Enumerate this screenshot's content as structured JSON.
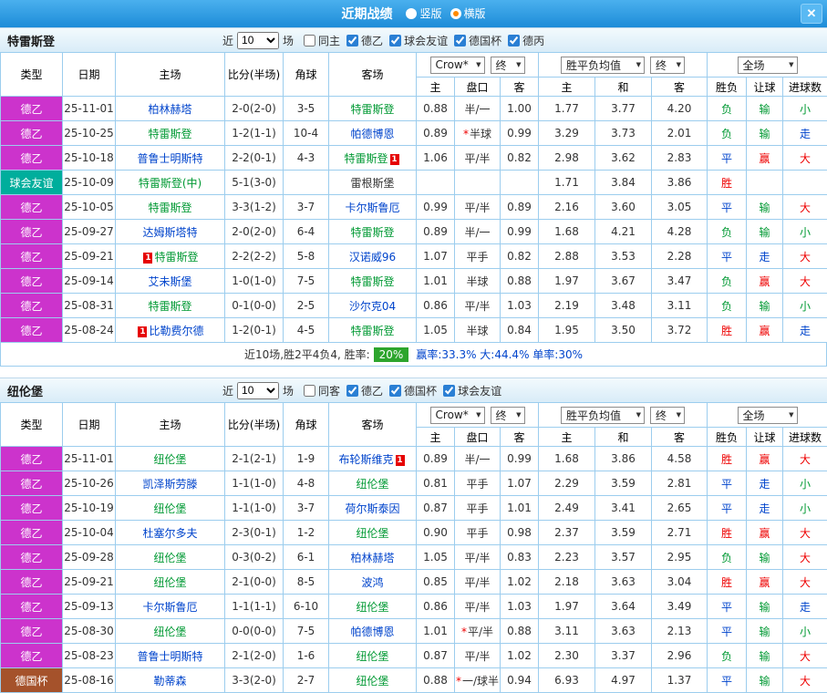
{
  "titlebar": {
    "title": "近期战绩",
    "radios": [
      {
        "label": "竖版",
        "selected": false
      },
      {
        "label": "横版",
        "selected": true
      }
    ],
    "close_glyph": "✕"
  },
  "dropdowns": {
    "company": "Crow*",
    "final": "终",
    "avg": "胜平负均值",
    "fulltime": "全场"
  },
  "table_headers": {
    "type": "类型",
    "date": "日期",
    "home": "主场",
    "score": "比分(半场)",
    "corners": "角球",
    "away": "客场",
    "odds_home": "主",
    "handicap": "盘口",
    "odds_away": "客",
    "avg_home": "主",
    "avg_draw": "和",
    "avg_away": "客",
    "result": "胜负",
    "let": "让球",
    "goals": "进球数"
  },
  "league_colors": {
    "德乙": "#cc33cc",
    "球会友谊": "#00ae9c",
    "德国杯": "#a5522b"
  },
  "sections": [
    {
      "team": "特雷斯登",
      "filters": {
        "prefix": "近",
        "count": "10",
        "suffix": "场",
        "options": [
          {
            "label": "同主",
            "checked": false
          },
          {
            "label": "德乙",
            "checked": true
          },
          {
            "label": "球会友谊",
            "checked": true
          },
          {
            "label": "德国杯",
            "checked": true
          },
          {
            "label": "德丙",
            "checked": true
          }
        ]
      },
      "rows": [
        {
          "league": "德乙",
          "date": "25-11-01",
          "home": "柏林赫塔",
          "home_style": "opp",
          "home_card": "",
          "home_card_pos": "",
          "score": "2-0(2-0)",
          "corners": "3-5",
          "away": "特雷斯登",
          "away_style": "focus",
          "away_card": "",
          "away_card_pos": "",
          "odds_home": "0.88",
          "handicap": "半/一",
          "odds_away": "1.00",
          "avg_home": "1.77",
          "avg_draw": "3.77",
          "avg_away": "4.20",
          "result": "负",
          "let_result": "输",
          "goals": "小"
        },
        {
          "league": "德乙",
          "date": "25-10-25",
          "home": "特雷斯登",
          "home_style": "focus",
          "home_card": "",
          "home_card_pos": "",
          "score": "1-2(1-1)",
          "corners": "10-4",
          "away": "帕德博恩",
          "away_style": "opp",
          "away_card": "",
          "away_card_pos": "",
          "odds_home": "0.89",
          "handicap": "*半球",
          "odds_away": "0.99",
          "avg_home": "3.29",
          "avg_draw": "3.73",
          "avg_away": "2.01",
          "result": "负",
          "let_result": "输",
          "goals": "走"
        },
        {
          "league": "德乙",
          "date": "25-10-18",
          "home": "普鲁士明斯特",
          "home_style": "opp",
          "home_card": "",
          "home_card_pos": "",
          "score": "2-2(0-1)",
          "corners": "4-3",
          "away": "特雷斯登",
          "away_style": "focus",
          "away_card": "1",
          "away_card_pos": "after",
          "odds_home": "1.06",
          "handicap": "平/半",
          "odds_away": "0.82",
          "avg_home": "2.98",
          "avg_draw": "3.62",
          "avg_away": "2.83",
          "result": "平",
          "let_result": "赢",
          "goals": "大"
        },
        {
          "league": "球会友谊",
          "date": "25-10-09",
          "home": "特雷斯登(中)",
          "home_style": "focus",
          "home_card": "",
          "home_card_pos": "",
          "score": "5-1(3-0)",
          "corners": "",
          "away": "雷根斯堡",
          "away_style": "plain",
          "away_card": "",
          "away_card_pos": "",
          "odds_home": "",
          "handicap": "",
          "odds_away": "",
          "avg_home": "1.71",
          "avg_draw": "3.84",
          "avg_away": "3.86",
          "result": "胜",
          "let_result": "",
          "goals": ""
        },
        {
          "league": "德乙",
          "date": "25-10-05",
          "home": "特雷斯登",
          "home_style": "focus",
          "home_card": "",
          "home_card_pos": "",
          "score": "3-3(1-2)",
          "corners": "3-7",
          "away": "卡尔斯鲁厄",
          "away_style": "opp",
          "away_card": "",
          "away_card_pos": "",
          "odds_home": "0.99",
          "handicap": "平/半",
          "odds_away": "0.89",
          "avg_home": "2.16",
          "avg_draw": "3.60",
          "avg_away": "3.05",
          "result": "平",
          "let_result": "输",
          "goals": "大"
        },
        {
          "league": "德乙",
          "date": "25-09-27",
          "home": "达姆斯塔特",
          "home_style": "opp",
          "home_card": "",
          "home_card_pos": "",
          "score": "2-0(2-0)",
          "corners": "6-4",
          "away": "特雷斯登",
          "away_style": "focus",
          "away_card": "",
          "away_card_pos": "",
          "odds_home": "0.89",
          "handicap": "半/一",
          "odds_away": "0.99",
          "avg_home": "1.68",
          "avg_draw": "4.21",
          "avg_away": "4.28",
          "result": "负",
          "let_result": "输",
          "goals": "小"
        },
        {
          "league": "德乙",
          "date": "25-09-21",
          "home": "特雷斯登",
          "home_style": "focus",
          "home_card": "1",
          "home_card_pos": "before",
          "score": "2-2(2-2)",
          "corners": "5-8",
          "away": "汉诺威96",
          "away_style": "opp",
          "away_card": "",
          "away_card_pos": "",
          "odds_home": "1.07",
          "handicap": "平手",
          "odds_away": "0.82",
          "avg_home": "2.88",
          "avg_draw": "3.53",
          "avg_away": "2.28",
          "result": "平",
          "let_result": "走",
          "goals": "大"
        },
        {
          "league": "德乙",
          "date": "25-09-14",
          "home": "艾未斯堡",
          "home_style": "opp",
          "home_card": "",
          "home_card_pos": "",
          "score": "1-0(1-0)",
          "corners": "7-5",
          "away": "特雷斯登",
          "away_style": "focus",
          "away_card": "",
          "away_card_pos": "",
          "odds_home": "1.01",
          "handicap": "半球",
          "odds_away": "0.88",
          "avg_home": "1.97",
          "avg_draw": "3.67",
          "avg_away": "3.47",
          "result": "负",
          "let_result": "赢",
          "goals": "大"
        },
        {
          "league": "德乙",
          "date": "25-08-31",
          "home": "特雷斯登",
          "home_style": "focus",
          "home_card": "",
          "home_card_pos": "",
          "score": "0-1(0-0)",
          "corners": "2-5",
          "away": "沙尔克04",
          "away_style": "opp",
          "away_card": "",
          "away_card_pos": "",
          "odds_home": "0.86",
          "handicap": "平/半",
          "odds_away": "1.03",
          "avg_home": "2.19",
          "avg_draw": "3.48",
          "avg_away": "3.11",
          "result": "负",
          "let_result": "输",
          "goals": "小"
        },
        {
          "league": "德乙",
          "date": "25-08-24",
          "home": "比勒费尔德",
          "home_style": "opp",
          "home_card": "1",
          "home_card_pos": "before",
          "score": "1-2(0-1)",
          "corners": "4-5",
          "away": "特雷斯登",
          "away_style": "focus",
          "away_card": "",
          "away_card_pos": "",
          "odds_home": "1.05",
          "handicap": "半球",
          "odds_away": "0.84",
          "avg_home": "1.95",
          "avg_draw": "3.50",
          "avg_away": "3.72",
          "result": "胜",
          "let_result": "赢",
          "goals": "走"
        }
      ],
      "summary": {
        "before": "近10场,胜2平4负4, 胜率:",
        "badge": "20%",
        "after": "赢率:33.3% 大:44.4% 单率:30%"
      }
    },
    {
      "team": "纽伦堡",
      "filters": {
        "prefix": "近",
        "count": "10",
        "suffix": "场",
        "options": [
          {
            "label": "同客",
            "checked": false
          },
          {
            "label": "德乙",
            "checked": true
          },
          {
            "label": "德国杯",
            "checked": true
          },
          {
            "label": "球会友谊",
            "checked": true
          }
        ]
      },
      "rows": [
        {
          "league": "德乙",
          "date": "25-11-01",
          "home": "纽伦堡",
          "home_style": "focus",
          "home_card": "",
          "home_card_pos": "",
          "score": "2-1(2-1)",
          "corners": "1-9",
          "away": "布轮斯维克",
          "away_style": "opp",
          "away_card": "1",
          "away_card_pos": "after",
          "odds_home": "0.89",
          "handicap": "半/一",
          "odds_away": "0.99",
          "avg_home": "1.68",
          "avg_draw": "3.86",
          "avg_away": "4.58",
          "result": "胜",
          "let_result": "赢",
          "goals": "大"
        },
        {
          "league": "德乙",
          "date": "25-10-26",
          "home": "凯泽斯劳滕",
          "home_style": "opp",
          "home_card": "",
          "home_card_pos": "",
          "score": "1-1(1-0)",
          "corners": "4-8",
          "away": "纽伦堡",
          "away_style": "focus",
          "away_card": "",
          "away_card_pos": "",
          "odds_home": "0.81",
          "handicap": "平手",
          "odds_away": "1.07",
          "avg_home": "2.29",
          "avg_draw": "3.59",
          "avg_away": "2.81",
          "result": "平",
          "let_result": "走",
          "goals": "小"
        },
        {
          "league": "德乙",
          "date": "25-10-19",
          "home": "纽伦堡",
          "home_style": "focus",
          "home_card": "",
          "home_card_pos": "",
          "score": "1-1(1-0)",
          "corners": "3-7",
          "away": "荷尔斯泰因",
          "away_style": "opp",
          "away_card": "",
          "away_card_pos": "",
          "odds_home": "0.87",
          "handicap": "平手",
          "odds_away": "1.01",
          "avg_home": "2.49",
          "avg_draw": "3.41",
          "avg_away": "2.65",
          "result": "平",
          "let_result": "走",
          "goals": "小"
        },
        {
          "league": "德乙",
          "date": "25-10-04",
          "home": "杜塞尔多夫",
          "home_style": "opp",
          "home_card": "",
          "home_card_pos": "",
          "score": "2-3(0-1)",
          "corners": "1-2",
          "away": "纽伦堡",
          "away_style": "focus",
          "away_card": "",
          "away_card_pos": "",
          "odds_home": "0.90",
          "handicap": "平手",
          "odds_away": "0.98",
          "avg_home": "2.37",
          "avg_draw": "3.59",
          "avg_away": "2.71",
          "result": "胜",
          "let_result": "赢",
          "goals": "大"
        },
        {
          "league": "德乙",
          "date": "25-09-28",
          "home": "纽伦堡",
          "home_style": "focus",
          "home_card": "",
          "home_card_pos": "",
          "score": "0-3(0-2)",
          "corners": "6-1",
          "away": "柏林赫塔",
          "away_style": "opp",
          "away_card": "",
          "away_card_pos": "",
          "odds_home": "1.05",
          "handicap": "平/半",
          "odds_away": "0.83",
          "avg_home": "2.23",
          "avg_draw": "3.57",
          "avg_away": "2.95",
          "result": "负",
          "let_result": "输",
          "goals": "大"
        },
        {
          "league": "德乙",
          "date": "25-09-21",
          "home": "纽伦堡",
          "home_style": "focus",
          "home_card": "",
          "home_card_pos": "",
          "score": "2-1(0-0)",
          "corners": "8-5",
          "away": "波鸿",
          "away_style": "opp",
          "away_card": "",
          "away_card_pos": "",
          "odds_home": "0.85",
          "handicap": "平/半",
          "odds_away": "1.02",
          "avg_home": "2.18",
          "avg_draw": "3.63",
          "avg_away": "3.04",
          "result": "胜",
          "let_result": "赢",
          "goals": "大"
        },
        {
          "league": "德乙",
          "date": "25-09-13",
          "home": "卡尔斯鲁厄",
          "home_style": "opp",
          "home_card": "",
          "home_card_pos": "",
          "score": "1-1(1-1)",
          "corners": "6-10",
          "away": "纽伦堡",
          "away_style": "focus",
          "away_card": "",
          "away_card_pos": "",
          "odds_home": "0.86",
          "handicap": "平/半",
          "odds_away": "1.03",
          "avg_home": "1.97",
          "avg_draw": "3.64",
          "avg_away": "3.49",
          "result": "平",
          "let_result": "输",
          "goals": "走"
        },
        {
          "league": "德乙",
          "date": "25-08-30",
          "home": "纽伦堡",
          "home_style": "focus",
          "home_card": "",
          "home_card_pos": "",
          "score": "0-0(0-0)",
          "corners": "7-5",
          "away": "帕德博恩",
          "away_style": "opp",
          "away_card": "",
          "away_card_pos": "",
          "odds_home": "1.01",
          "handicap": "*平/半",
          "odds_away": "0.88",
          "avg_home": "3.11",
          "avg_draw": "3.63",
          "avg_away": "2.13",
          "result": "平",
          "let_result": "输",
          "goals": "小"
        },
        {
          "league": "德乙",
          "date": "25-08-23",
          "home": "普鲁士明斯特",
          "home_style": "opp",
          "home_card": "",
          "home_card_pos": "",
          "score": "2-1(2-0)",
          "corners": "1-6",
          "away": "纽伦堡",
          "away_style": "focus",
          "away_card": "",
          "away_card_pos": "",
          "odds_home": "0.87",
          "handicap": "平/半",
          "odds_away": "1.02",
          "avg_home": "2.30",
          "avg_draw": "3.37",
          "avg_away": "2.96",
          "result": "负",
          "let_result": "输",
          "goals": "大"
        },
        {
          "league": "德国杯",
          "date": "25-08-16",
          "home": "勒蒂森",
          "home_style": "opp",
          "home_card": "",
          "home_card_pos": "",
          "score": "3-3(2-0)",
          "corners": "2-7",
          "away": "纽伦堡",
          "away_style": "focus",
          "away_card": "",
          "away_card_pos": "",
          "odds_home": "0.88",
          "handicap": "*一/球半",
          "odds_away": "0.94",
          "avg_home": "6.93",
          "avg_draw": "4.97",
          "avg_away": "1.37",
          "result": "平",
          "let_result": "输",
          "goals": "大"
        }
      ],
      "summary": null
    }
  ]
}
